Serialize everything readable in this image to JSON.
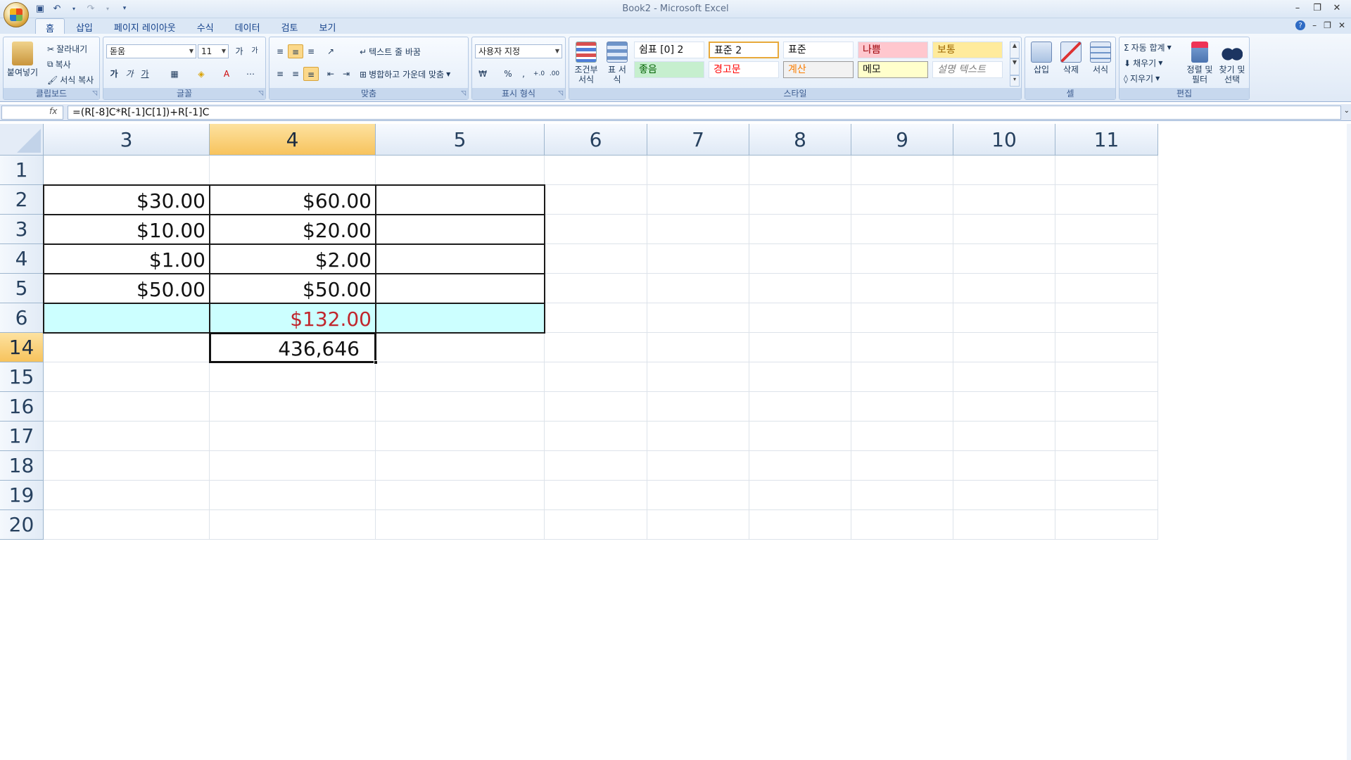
{
  "window": {
    "title": "Book2 - Microsoft Excel"
  },
  "tabs": [
    "홈",
    "삽입",
    "페이지 레이아웃",
    "수식",
    "데이터",
    "검토",
    "보기"
  ],
  "active_tab": "홈",
  "ribbon": {
    "clipboard": {
      "label": "클립보드",
      "paste": "붙여넣기",
      "cut": "잘라내기",
      "copy": "복사",
      "format_painter": "서식 복사"
    },
    "font": {
      "label": "글꼴",
      "font_name": "돋움",
      "font_size": "11",
      "bold": "가",
      "italic": "가",
      "underline": "가"
    },
    "alignment": {
      "label": "맞춤",
      "wrap_text": "텍스트 줄 바꿈",
      "merge_center": "병합하고 가운데 맞춤"
    },
    "number": {
      "label": "표시 형식",
      "format": "사용자 지정",
      "currency": "₩",
      "percent": "%",
      "comma": ",",
      "inc_decimal": "+.0",
      "dec_decimal": ".00"
    },
    "styles": {
      "label": "스타일",
      "conditional_format": "조건부 서식",
      "format_table": "표 서식",
      "gallery": [
        {
          "text": "쉼표 [0] 2",
          "bg": "#ffffff",
          "color": "#111111",
          "style": "normal"
        },
        {
          "text": "표준 2",
          "bg": "#ffffff",
          "color": "#111111",
          "style": "selected"
        },
        {
          "text": "표준",
          "bg": "#ffffff",
          "color": "#111111",
          "style": "normal"
        },
        {
          "text": "나쁨",
          "bg": "#ffc7ce",
          "color": "#9c0006",
          "style": "normal"
        },
        {
          "text": "보통",
          "bg": "#ffeb9c",
          "color": "#9c6500",
          "style": "normal"
        },
        {
          "text": "좋음",
          "bg": "#c6efce",
          "color": "#006100",
          "style": "normal"
        },
        {
          "text": "경고문",
          "bg": "#ffffff",
          "color": "#ff0000",
          "style": "normal"
        },
        {
          "text": "계산",
          "bg": "#f2f2f2",
          "color": "#fa7d00",
          "style": "boxed"
        },
        {
          "text": "메모",
          "bg": "#ffffcc",
          "color": "#111111",
          "style": "boxed"
        },
        {
          "text": "설명 텍스트",
          "bg": "#ffffff",
          "color": "#7f7f7f",
          "style": "italic"
        }
      ]
    },
    "cells": {
      "label": "셀",
      "insert": "삽입",
      "delete": "삭제",
      "format": "서식"
    },
    "editing": {
      "label": "편집",
      "autosum": "자동 합계",
      "fill": "채우기",
      "clear": "지우기",
      "sort_filter": "정렬 및 필터",
      "find_select": "찾기 및 선택"
    }
  },
  "formula_bar": {
    "name_box": "",
    "fx": "fx",
    "formula": "=(R[-8]C*R[-1]C[1])+R[-1]C"
  },
  "grid": {
    "columns": [
      "3",
      "4",
      "5",
      "6",
      "7",
      "8",
      "9",
      "10",
      "11"
    ],
    "active_column": "4",
    "rows": [
      "1",
      "2",
      "3",
      "4",
      "5",
      "6",
      "14",
      "15",
      "16",
      "17",
      "18",
      "19",
      "20"
    ],
    "active_row": "14",
    "cells": [
      {
        "row": "2",
        "col": "3",
        "value": "$30.00"
      },
      {
        "row": "2",
        "col": "4",
        "value": "$60.00"
      },
      {
        "row": "3",
        "col": "3",
        "value": "$10.00"
      },
      {
        "row": "3",
        "col": "4",
        "value": "$20.00"
      },
      {
        "row": "4",
        "col": "3",
        "value": "$1.00"
      },
      {
        "row": "4",
        "col": "4",
        "value": "$2.00"
      },
      {
        "row": "5",
        "col": "3",
        "value": "$50.00"
      },
      {
        "row": "5",
        "col": "4",
        "value": "$50.00"
      },
      {
        "row": "6",
        "col": "4",
        "value": "$132.00"
      },
      {
        "row": "14",
        "col": "4",
        "value": "436,646"
      }
    ],
    "highlight_fill": "#ccffff",
    "total_color": "#c0262d"
  }
}
